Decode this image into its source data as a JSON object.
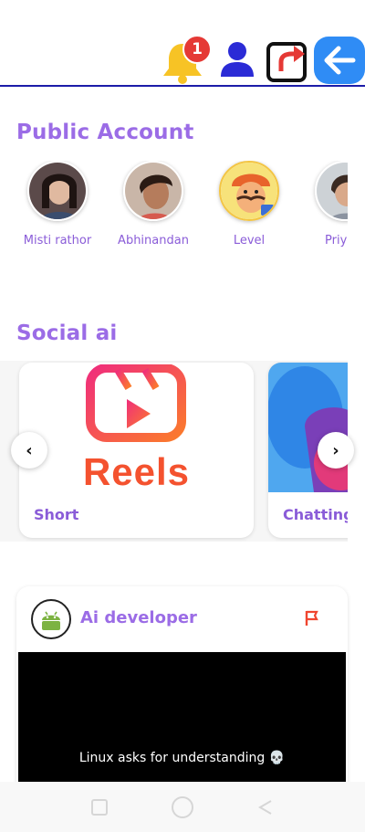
{
  "header": {
    "notification_count": "1",
    "icons": [
      "bell-icon",
      "profile-icon",
      "share-icon",
      "back-arrow-icon"
    ],
    "colors": {
      "bell": "#f7c325",
      "badge": "#e53935",
      "profile": "#2b2bd6",
      "back": "#2f8cf5",
      "divider": "#1c1ca8"
    }
  },
  "public_account": {
    "title": "Public Account",
    "accounts": [
      {
        "name": "Misti rathor"
      },
      {
        "name": "Abhinandan"
      },
      {
        "name": "Level"
      },
      {
        "name": "Priya k"
      }
    ]
  },
  "social_ai": {
    "title": "Social ai",
    "cards": [
      {
        "label": "Short",
        "image_text": "Reels"
      },
      {
        "label": "Chatting"
      }
    ]
  },
  "post": {
    "author": "Ai developer",
    "caption": "Linux asks for understanding 💀"
  },
  "accent_color": "#9b6ce6"
}
